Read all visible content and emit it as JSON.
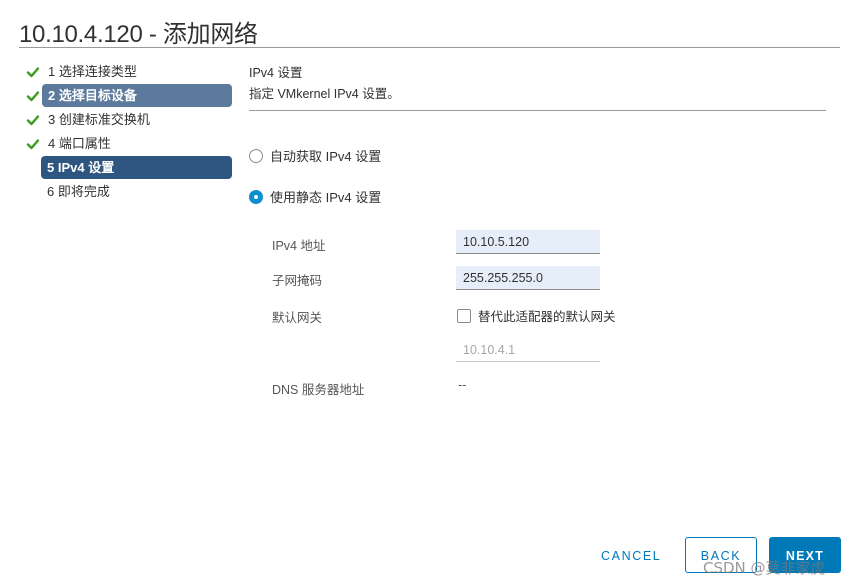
{
  "dialog": {
    "title": "10.10.4.120 - 添加网络"
  },
  "steps": [
    {
      "label": "1 选择连接类型",
      "state": "done"
    },
    {
      "label": "2 选择目标设备",
      "state": "done-visited"
    },
    {
      "label": "3 创建标准交换机",
      "state": "done"
    },
    {
      "label": "4 端口属性",
      "state": "done"
    },
    {
      "label": "5 IPv4 设置",
      "state": "current"
    },
    {
      "label": "6 即将完成",
      "state": "pending"
    }
  ],
  "section": {
    "title": "IPv4 设置",
    "description": "指定 VMkernel IPv4 设置。"
  },
  "options": {
    "auto": {
      "label": "自动获取 IPv4 设置",
      "checked": false
    },
    "static": {
      "label": "使用静态 IPv4 设置",
      "checked": true
    }
  },
  "fields": {
    "ipv4_address": {
      "label": "IPv4 地址",
      "value": "10.10.5.120"
    },
    "subnet_mask": {
      "label": "子网掩码",
      "value": "255.255.255.0"
    },
    "default_gateway": {
      "label": "默认网关",
      "override_label": "替代此适配器的默认网关",
      "override_checked": false,
      "value": "10.10.4.1"
    },
    "dns": {
      "label": "DNS 服务器地址",
      "value": "--"
    }
  },
  "buttons": {
    "cancel": "CANCEL",
    "back": "BACK",
    "next": "NEXT"
  },
  "watermark": "CSDN @莫非家虎",
  "colors": {
    "accent": "#0079b8",
    "radio_checked": "#0a8ed2",
    "step_current_bg": "#2e5680",
    "step_visited_bg": "#5b7a9c",
    "check_green": "#3c9b1f",
    "input_bg": "#e6eefa"
  }
}
